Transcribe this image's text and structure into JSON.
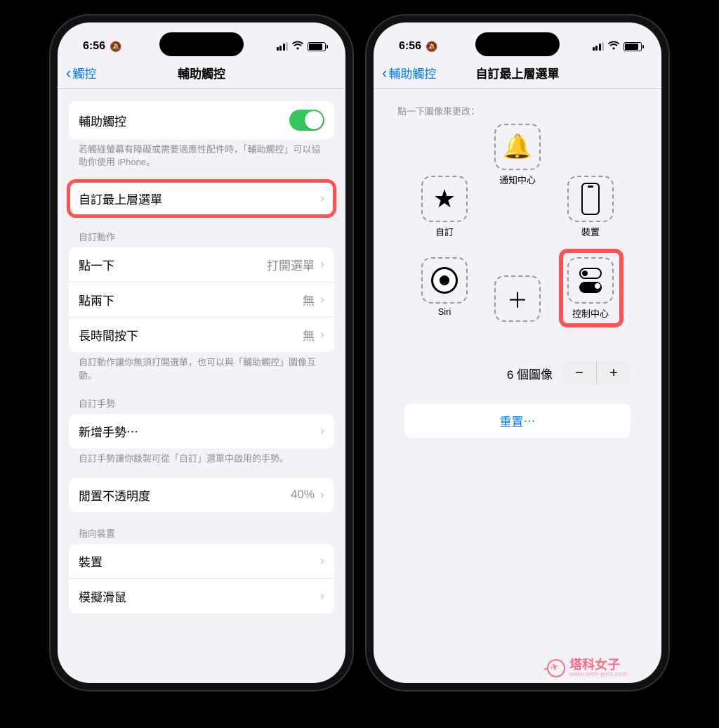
{
  "status": {
    "time": "6:56",
    "silent": true
  },
  "left_phone": {
    "nav": {
      "back": "觸控",
      "title": "輔助觸控"
    },
    "toggle_label": "輔助觸控",
    "toggle_on": true,
    "toggle_footer": "若觸碰螢幕有障礙或需要適應性配件時，「輔助觸控」可以協助你使用 iPhone。",
    "customize_row": "自訂最上層選單",
    "actions_header": "自訂動作",
    "actions": [
      {
        "label": "點一下",
        "value": "打開選單"
      },
      {
        "label": "點兩下",
        "value": "無"
      },
      {
        "label": "長時間按下",
        "value": "無"
      }
    ],
    "actions_footer": "自訂動作讓你無須打開選單，也可以與「輔助觸控」圖像互動。",
    "gestures_header": "自訂手勢",
    "gestures_row": "新增手勢⋯",
    "gestures_footer": "自訂手勢讓你錄製可從「自訂」選單中啟用的手勢。",
    "opacity_label": "閒置不透明度",
    "opacity_value": "40%",
    "pointer_header": "指向裝置",
    "pointer_rows": [
      {
        "label": "裝置"
      },
      {
        "label": "模擬滑鼠"
      }
    ]
  },
  "right_phone": {
    "nav": {
      "back": "輔助觸控",
      "title": "自訂最上層選單"
    },
    "hint": "點一下圖像來更改：",
    "tiles": {
      "top": {
        "label": "通知中心"
      },
      "left": {
        "label": "自訂"
      },
      "right": {
        "label": "裝置"
      },
      "bl": {
        "label": "Siri"
      },
      "bc": {
        "label": ""
      },
      "br": {
        "label": "控制中心"
      }
    },
    "count_label": "6 個圖像",
    "reset": "重置⋯"
  },
  "watermark": {
    "title": "塔科女子",
    "sub": "www.tech-girlz.com"
  }
}
